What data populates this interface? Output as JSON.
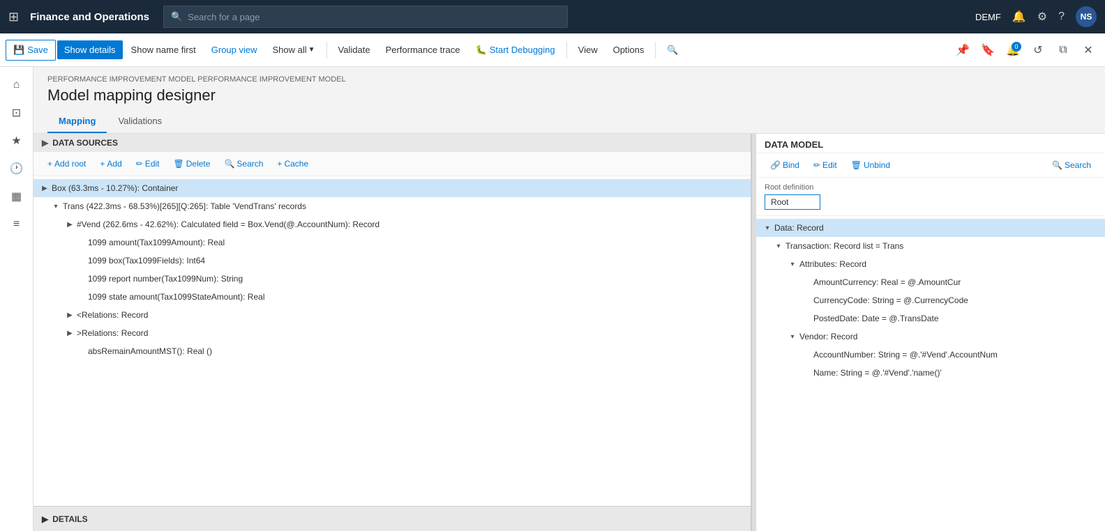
{
  "app": {
    "title": "Finance and Operations",
    "env": "DEMF",
    "user_initials": "NS"
  },
  "search_bar": {
    "placeholder": "Search for a page"
  },
  "toolbar": {
    "save_label": "Save",
    "show_details_label": "Show details",
    "show_name_first_label": "Show name first",
    "group_view_label": "Group view",
    "show_all_label": "Show all",
    "validate_label": "Validate",
    "performance_trace_label": "Performance trace",
    "start_debugging_label": "Start Debugging",
    "view_label": "View",
    "options_label": "Options"
  },
  "breadcrumb": "PERFORMANCE IMPROVEMENT MODEL PERFORMANCE IMPROVEMENT MODEL",
  "page_title": "Model mapping designer",
  "tabs": [
    {
      "label": "Mapping",
      "active": true
    },
    {
      "label": "Validations",
      "active": false
    }
  ],
  "data_sources_panel": {
    "header": "DATA SOURCES",
    "buttons": [
      {
        "label": "Add root",
        "icon": "+"
      },
      {
        "label": "Add",
        "icon": "+"
      },
      {
        "label": "Edit",
        "icon": "✏"
      },
      {
        "label": "Delete",
        "icon": "🗑"
      },
      {
        "label": "Search",
        "icon": "🔍"
      },
      {
        "label": "Cache",
        "icon": "+"
      }
    ],
    "tree": [
      {
        "id": "box",
        "indent": 0,
        "expanded": true,
        "selected": true,
        "label": "Box (63.3ms - 10.27%): Container",
        "children": [
          {
            "id": "trans",
            "indent": 1,
            "expanded": true,
            "label": "Trans (422.3ms - 68.53%)[265][Q:265]: Table 'VendTrans' records",
            "children": [
              {
                "id": "vend",
                "indent": 2,
                "expanded": false,
                "label": "#Vend (262.6ms - 42.62%): Calculated field = Box.Vend(@.AccountNum): Record",
                "children": []
              },
              {
                "id": "tax1099amount",
                "indent": 3,
                "expanded": false,
                "label": "1099 amount(Tax1099Amount): Real",
                "children": []
              },
              {
                "id": "tax1099fields",
                "indent": 3,
                "expanded": false,
                "label": "1099 box(Tax1099Fields): Int64",
                "children": []
              },
              {
                "id": "tax1099num",
                "indent": 3,
                "expanded": false,
                "label": "1099 report number(Tax1099Num): String",
                "children": []
              },
              {
                "id": "tax1099stateamount",
                "indent": 3,
                "expanded": false,
                "label": "1099 state amount(Tax1099StateAmount): Real",
                "children": []
              },
              {
                "id": "relations_lt",
                "indent": 3,
                "expanded": false,
                "label": "<Relations: Record",
                "children": []
              },
              {
                "id": "relations_gt",
                "indent": 3,
                "expanded": false,
                "label": ">Relations: Record",
                "children": []
              },
              {
                "id": "abs_remain",
                "indent": 3,
                "expanded": false,
                "label": "absRemainAmountMST(): Real ()",
                "children": []
              }
            ]
          }
        ]
      }
    ]
  },
  "data_model_panel": {
    "header": "DATA MODEL",
    "buttons": [
      {
        "label": "Bind",
        "icon": "🔗"
      },
      {
        "label": "Edit",
        "icon": "✏"
      },
      {
        "label": "Unbind",
        "icon": "🗑"
      },
      {
        "label": "Search",
        "icon": "🔍"
      }
    ],
    "root_definition_label": "Root definition",
    "root_definition_value": "Root",
    "tree": [
      {
        "id": "data_record",
        "indent": 0,
        "expanded": true,
        "selected": true,
        "label": "Data: Record",
        "children": [
          {
            "id": "transaction",
            "indent": 1,
            "expanded": true,
            "label": "Transaction: Record list = Trans",
            "children": [
              {
                "id": "attributes",
                "indent": 2,
                "expanded": true,
                "label": "Attributes: Record",
                "children": [
                  {
                    "id": "amount_currency",
                    "indent": 3,
                    "label": "AmountCurrency: Real = @.AmountCur"
                  },
                  {
                    "id": "currency_code",
                    "indent": 3,
                    "label": "CurrencyCode: String = @.CurrencyCode"
                  },
                  {
                    "id": "posted_date",
                    "indent": 3,
                    "label": "PostedDate: Date = @.TransDate"
                  }
                ]
              },
              {
                "id": "vendor",
                "indent": 2,
                "expanded": true,
                "label": "Vendor: Record",
                "children": [
                  {
                    "id": "account_number",
                    "indent": 3,
                    "label": "AccountNumber: String = @.'#Vend'.AccountNum"
                  },
                  {
                    "id": "name",
                    "indent": 3,
                    "label": "Name: String = @.'#Vend'.'name()'"
                  }
                ]
              }
            ]
          }
        ]
      }
    ]
  },
  "details_panel": {
    "label": "DETAILS"
  }
}
